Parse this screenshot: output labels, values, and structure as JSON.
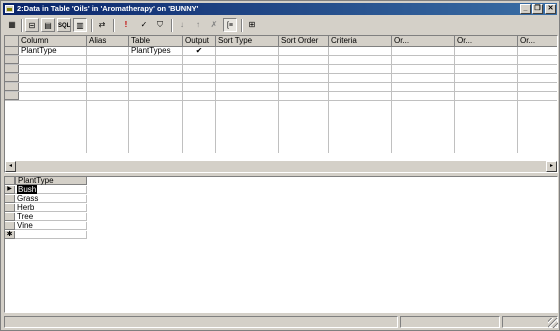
{
  "window": {
    "title": "2:Data in Table 'Oils' in 'Aromatherapy' on 'BUNNY'",
    "controls": {
      "minimize": "_",
      "restore": "❐",
      "close": "✕"
    }
  },
  "toolbar": {
    "buttons": [
      {
        "icon": "design-view-icon",
        "glyph": "▦"
      },
      {
        "icon": "diagram-pane-icon",
        "glyph": "⊟"
      },
      {
        "icon": "grid-pane-icon",
        "glyph": "▤"
      },
      {
        "icon": "sql-pane-icon",
        "glyph": "SQL"
      },
      {
        "icon": "results-pane-icon",
        "glyph": "▥"
      },
      {
        "icon": "change-type-icon",
        "glyph": "⇄"
      },
      {
        "icon": "run-icon",
        "glyph": "!"
      },
      {
        "icon": "verify-sql-icon",
        "glyph": "✓"
      },
      {
        "icon": "filter-icon",
        "glyph": "⛉"
      },
      {
        "icon": "sort-ascending-icon",
        "glyph": "↓"
      },
      {
        "icon": "sort-descending-icon",
        "glyph": "↑"
      },
      {
        "icon": "remove-filter-icon",
        "glyph": "✗"
      },
      {
        "icon": "group-by-icon",
        "glyph": "[≡"
      },
      {
        "icon": "add-table-icon",
        "glyph": "⊞"
      }
    ]
  },
  "criteria_grid": {
    "columns": [
      "Column",
      "Alias",
      "Table",
      "Output",
      "Sort Type",
      "Sort Order",
      "Criteria",
      "Or...",
      "Or...",
      "Or..."
    ],
    "rows": [
      {
        "column": "PlantType",
        "alias": "",
        "table": "PlantTypes",
        "output": "✔"
      }
    ]
  },
  "scrollbar": {
    "left": "◂",
    "right": "▸"
  },
  "results": {
    "header": "PlantType",
    "row_pointer": "▶",
    "new_row": "✱",
    "rows": [
      "Bush",
      "Grass",
      "Herb",
      "Tree",
      "Vine"
    ]
  }
}
